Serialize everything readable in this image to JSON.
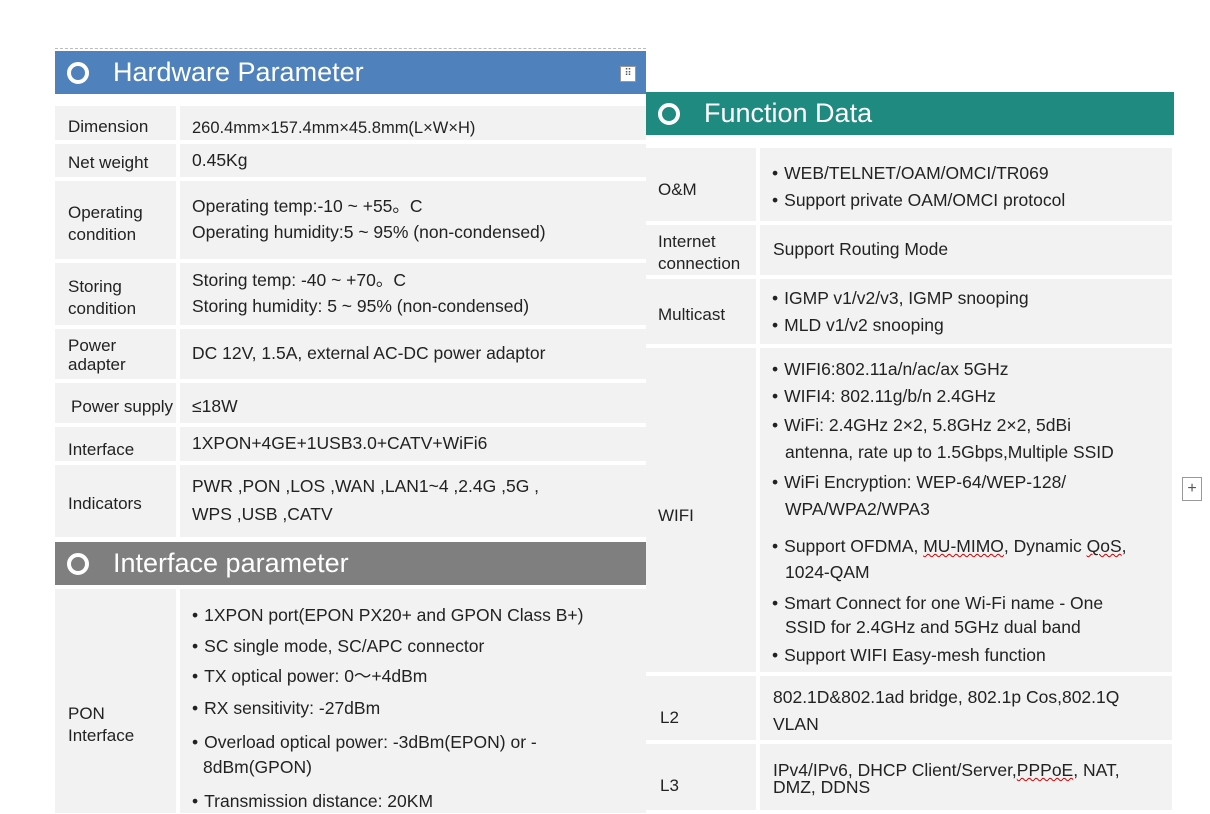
{
  "hardware": {
    "title": "Hardware Parameter",
    "rows": [
      {
        "label": "Dimension",
        "value": "260.4mm×157.4mm×45.8mm(L×W×H)"
      },
      {
        "label": "Net weight",
        "value": "0.45Kg"
      },
      {
        "label": [
          "Operating",
          "condition"
        ],
        "value": [
          "Operating temp:-10 ~ +55。C",
          "Operating humidity:5 ~ 95%  (non-condensed)"
        ]
      },
      {
        "label": [
          "Storing",
          "condition"
        ],
        "value": [
          "Storing temp: -40 ~ +70。C",
          "Storing humidity: 5 ~ 95%  (non-condensed)"
        ]
      },
      {
        "label": [
          "Power",
          "adapter"
        ],
        "value": "DC  12V, 1.5A, external AC-DC power adaptor"
      },
      {
        "label": "Power supply",
        "value": "≤18W"
      },
      {
        "label": "Interface",
        "value": "1XPON+4GE+1USB3.0+CATV+WiFi6"
      },
      {
        "label": "Indicators",
        "value": [
          "PWR ,PON ,LOS ,WAN ,LAN1~4 ,2.4G ,5G ,",
          "WPS ,USB ,CATV"
        ]
      }
    ]
  },
  "interface": {
    "title": "Interface parameter",
    "pon_label": [
      "PON",
      "Interface"
    ],
    "pon_items": [
      "1XPON port(EPON PX20+ and GPON Class B+)",
      "SC single mode, SC/APC connector",
      "TX optical power: 0～+4dBm",
      "RX sensitivity: -27dBm",
      "Overload optical power: -3dBm(EPON) or  -",
      "8dBm(GPON)",
      "Transmission distance: 20KM"
    ]
  },
  "function": {
    "title": "Function Data",
    "rows": [
      {
        "label": "O&M",
        "items": [
          "WEB/TELNET/OAM/OMCI/TR069",
          "Support private OAM/OMCI protocol"
        ]
      },
      {
        "label": [
          "Internet",
          "connection"
        ],
        "value": "Support  Routing  Mode"
      },
      {
        "label": "Multicast",
        "items": [
          "IGMP v1/v2/v3,  IGMP snooping",
          "MLD v1/v2 snooping"
        ]
      },
      {
        "label": "WIFI",
        "items": [
          "WIFI6:802.11a/n/ac/ax 5GHz",
          "WIFI4: 802.11g/b/n  2.4GHz",
          "WiFi: 2.4GHz 2×2, 5.8GHz 2×2, 5dBi",
          "antenna, rate up to 1.5Gbps,Multiple SSID",
          "WiFi  Encryption: WEP-64/WEP-128/",
          "WPA/WPA2/WPA3",
          "Support OFDMA,",
          "MU-MIMO",
          ", Dynamic",
          "QoS",
          ",",
          "1024-QAM",
          "Smart Connect for one Wi-Fi name - One",
          "SSID for 2.4GHz and 5GHz dual band",
          "Support WIFI  Easy-mesh function"
        ]
      },
      {
        "label": "L2",
        "value": [
          "802.1D&802.1ad bridge, 802.1p Cos,802.1Q",
          "VLAN"
        ]
      },
      {
        "label": "L3",
        "value": [
          "IPv4/IPv6,  DHCP Client/Server,",
          "PPPoE",
          ", NAT,",
          "DMZ,  DDNS"
        ]
      }
    ]
  },
  "colors": {
    "hardware_header": "#4f81bd",
    "interface_header": "#7f7f7f",
    "function_header": "#1f8a80",
    "row_bg": "#f2f2f2"
  },
  "icons": {
    "drag_handle": "grid-dots-icon",
    "add_button": "plus-icon",
    "header_marker": "circle-icon"
  }
}
